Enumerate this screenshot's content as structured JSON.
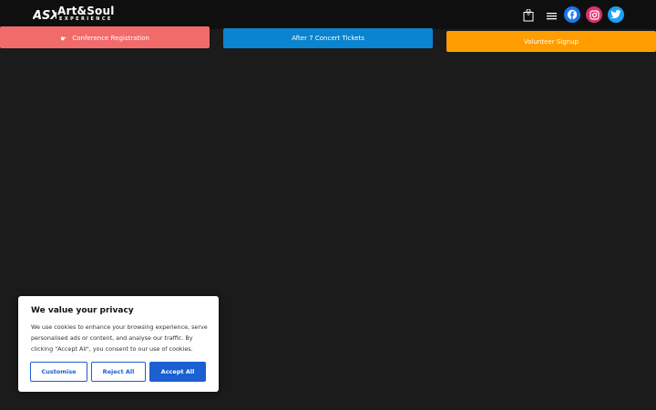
{
  "header": {
    "brand": {
      "title": "Art&Soul",
      "subtitle": "EXPERIENCE",
      "mark": "ASX"
    },
    "cart": {
      "count": "0",
      "icon": "shopping-bag-icon"
    },
    "menu_icon": "hamburger-menu-icon",
    "social": [
      {
        "name": "Facebook",
        "icon": "facebook-icon",
        "color": "#1877f2"
      },
      {
        "name": "Instagram",
        "icon": "instagram-icon",
        "color": "#e1306c"
      },
      {
        "name": "Twitter",
        "icon": "twitter-icon",
        "color": "#1da1f2"
      }
    ]
  },
  "actions": {
    "conference": {
      "label": "Conference Registration",
      "icon": "pointing-hand-icon",
      "color": "#f26b6b"
    },
    "after7": {
      "label": "After 7 Concert Tickets",
      "color": "#0b84d0"
    },
    "volunteer": {
      "label": "Volunteer Signup",
      "color": "#ff9d00"
    }
  },
  "cookie": {
    "title": "We value your privacy",
    "text": "We use cookies to enhance your browsing experience, serve personalised ads or content, and analyse our traffic. By clicking \"Accept All\", you consent to our use of cookies.",
    "buttons": {
      "customise": "Customise",
      "reject": "Reject All",
      "accept": "Accept All"
    },
    "accent": "#1b5fd1"
  }
}
